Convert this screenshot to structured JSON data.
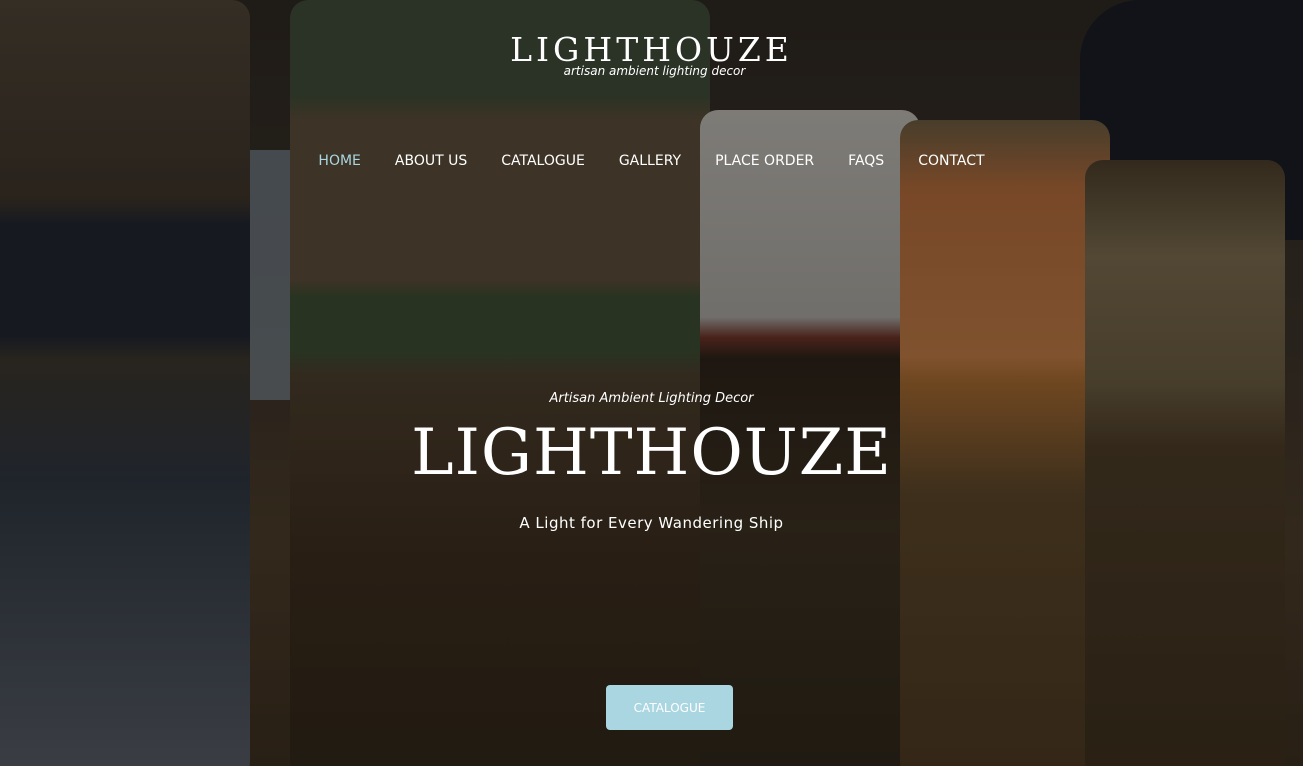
{
  "brand": {
    "name": "LIGHTHOUZE",
    "tagline": "artisan ambient lighting decor"
  },
  "nav": {
    "items": [
      {
        "label": "HOME",
        "active": true
      },
      {
        "label": "ABOUT US",
        "active": false
      },
      {
        "label": "CATALOGUE",
        "active": false
      },
      {
        "label": "GALLERY",
        "active": false
      },
      {
        "label": "PLACE ORDER",
        "active": false
      },
      {
        "label": "FAQS",
        "active": false
      },
      {
        "label": "CONTACT",
        "active": false
      }
    ]
  },
  "hero": {
    "subtitle": "Artisan Ambient Lighting Decor",
    "title": "LIGHTHOUZE",
    "slogan": "A Light for Every Wandering Ship",
    "cta_label": "CATALOGUE"
  },
  "colors": {
    "accent": "#a9d6e0",
    "text": "#ffffff"
  }
}
